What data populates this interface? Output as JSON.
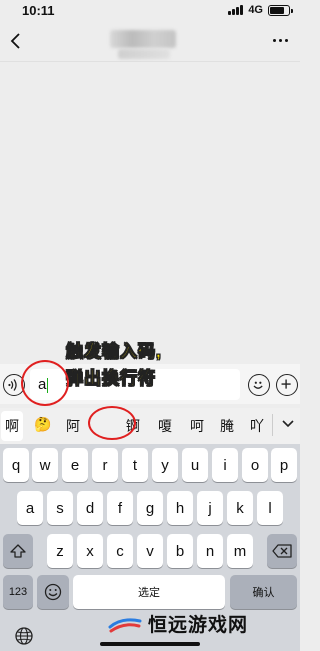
{
  "status": {
    "time": "10:11",
    "network": "4G",
    "battery_level": 0.8
  },
  "nav": {
    "back_icon": "chevron-left-icon",
    "more_icon": "more-dots-icon"
  },
  "input": {
    "value": "a"
  },
  "caption": {
    "line1": "触发输入码,",
    "line2": "弹出换行符"
  },
  "candidates": [
    "啊",
    "🤔",
    "阿",
    "",
    "锕",
    "嗄",
    "呵",
    "腌",
    "吖"
  ],
  "keyboard": {
    "row1": [
      "q",
      "w",
      "e",
      "r",
      "t",
      "y",
      "u",
      "i",
      "o",
      "p"
    ],
    "row2": [
      "a",
      "s",
      "d",
      "f",
      "g",
      "h",
      "j",
      "k",
      "l"
    ],
    "row3": [
      "z",
      "x",
      "c",
      "v",
      "b",
      "n",
      "m"
    ],
    "numbers_label": "123",
    "space_label": "选定",
    "confirm_label": "确认"
  },
  "watermark": {
    "text": "恒远游戏网"
  },
  "colors": {
    "caption": "#ffe600",
    "annotation": "#e02020",
    "cursor": "#1aad19"
  }
}
